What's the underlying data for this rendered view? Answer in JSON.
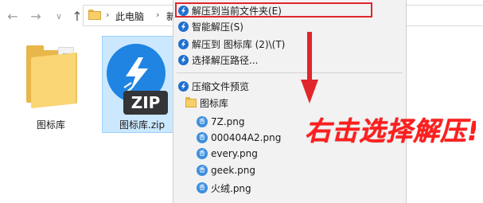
{
  "address_bar": {
    "back": "←",
    "forward": "→",
    "dropdown": "∨",
    "up": "↑",
    "separator": "›",
    "path": [
      "此电脑",
      "新"
    ]
  },
  "files": [
    {
      "name": "图标库",
      "type": "folder",
      "selected": false
    },
    {
      "name": "图标库.zip",
      "type": "zip",
      "selected": true,
      "badge": "ZIP"
    }
  ],
  "context_menu": {
    "items": [
      {
        "label": "解压到当前文件夹(E)",
        "highlighted": true
      },
      {
        "label": "智能解压(S)"
      },
      {
        "label": "解压到 图标库 (2)\\(T)"
      },
      {
        "label": "选择解压路径..."
      }
    ],
    "preview": {
      "label": "压缩文件预览",
      "folder": "图标库",
      "files": [
        "7Z.png",
        "000404A2.png",
        "every.png",
        "geek.png",
        "火绒.png"
      ],
      "file_icon_glyph": "香"
    }
  },
  "annotation": {
    "text": "右击选择解压!",
    "color": "#ff1e1e"
  },
  "colors": {
    "accent": "#1f84e2",
    "selection": "#cce8ff",
    "highlight_border": "#e0262b"
  }
}
